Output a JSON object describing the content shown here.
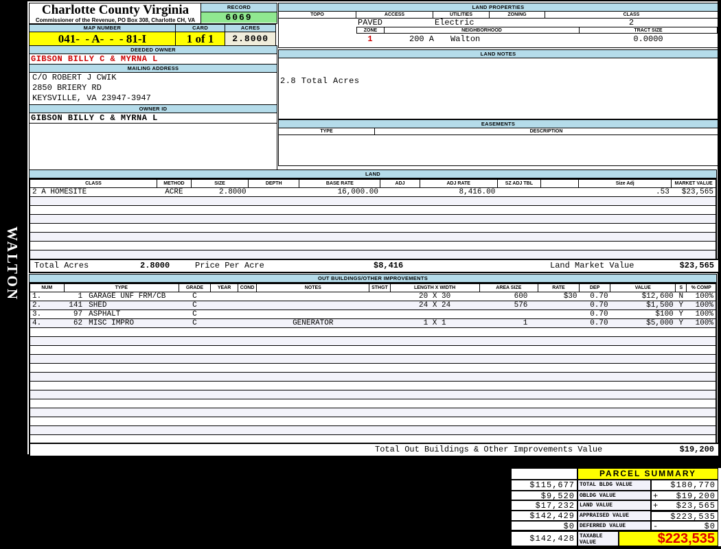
{
  "app": {
    "title": "Charlotte County Virginia",
    "subtitle": "Commissioner of the Revenue, PO Box 308, Charlotte CH, VA"
  },
  "sidebar": {
    "vertical_label": "WALTON"
  },
  "record": {
    "label": "RECORD",
    "value": "6069"
  },
  "map": {
    "label": "MAP NUMBER",
    "value": "041-  - A-  -  - 81-I"
  },
  "card": {
    "label": "CARD",
    "value": "1 of 1"
  },
  "acres": {
    "label": "ACRES",
    "value": "2.8000"
  },
  "owner": {
    "deeded_owner_label": "DEEDED OWNER",
    "deeded_owner": "GIBSON BILLY C & MYRNA L",
    "mailing_address_label": "MAILING ADDRESS",
    "mailing_address_lines": [
      "C/O ROBERT J CWIK",
      "2850 BRIERY RD",
      "KEYSVILLE, VA 23947-3947"
    ],
    "owner_id_label": "OWNER ID",
    "owner_id": "GIBSON BILLY C & MYRNA L"
  },
  "land_properties": {
    "title": "LAND PROPERTIES",
    "columns": [
      "TOPO",
      "ACCESS",
      "UTILITIES",
      "ZONING",
      "CLASS"
    ],
    "topo": "",
    "access": "PAVED",
    "utilities": "Electric",
    "zoning": "",
    "class": "2",
    "zone_label": "ZONE",
    "zone": "1",
    "zone_area": "200 A",
    "neighborhood_label": "NEIGHBORHOOD",
    "neighborhood": "Walton",
    "tract_size_label": "TRACT SIZE",
    "tract_size": "0.0000"
  },
  "land_notes": {
    "title": "LAND NOTES",
    "note": "2.8 Total Acres"
  },
  "easements": {
    "title": "EASEMENTS",
    "type_label": "TYPE",
    "description_label": "DESCRIPTION"
  },
  "land_table": {
    "title": "LAND",
    "columns": [
      "CLASS",
      "METHOD",
      "SIZE",
      "DEPTH",
      "BASE RATE",
      "ADJ",
      "ADJ RATE",
      "SZ ADJ TBL",
      "",
      "Size Adj",
      "MARKET VALUE"
    ],
    "row": {
      "cls": "2 A HOMESITE",
      "method": "ACRE",
      "size": "2.8000",
      "depth": "",
      "base_rate": "16,000.00",
      "adj": "",
      "adj_rate": "8,416.00",
      "sz_adj_tbl": "",
      "blank": "",
      "size_adj": ".53",
      "market_value": "$23,565"
    },
    "totals": {
      "acres_label": "Total Acres",
      "acres": "2.8000",
      "ppa_label": "Price Per Acre",
      "ppa": "$8,416",
      "lmv_label": "Land Market Value",
      "lmv": "$23,565"
    }
  },
  "outbuildings": {
    "title": "OUT BUILDINGS/OTHER IMPROVEMENTS",
    "columns": [
      "NUM",
      "TYPE",
      "GRADE",
      "YEAR",
      "COND",
      "NOTES",
      "STHGT",
      "LENGTH X WIDTH",
      "AREA SIZE",
      "RATE",
      "DEP",
      "VALUE",
      "S",
      "% COMP"
    ],
    "rows": [
      {
        "num": "1.",
        "code": "1",
        "name": "GARAGE UNF FRM/CB",
        "grade": "C",
        "year": "",
        "cond": "",
        "notes": "",
        "sthgt": "",
        "dims": "20 X 30",
        "area": "600",
        "rate": "$30",
        "dep": "0.70",
        "value": "$12,600",
        "s": "N",
        "comp": "100%"
      },
      {
        "num": "2.",
        "code": "141",
        "name": "SHED",
        "grade": "C",
        "year": "",
        "cond": "",
        "notes": "",
        "sthgt": "",
        "dims": "24 X 24",
        "area": "576",
        "rate": "",
        "dep": "0.70",
        "value": "$1,500",
        "s": "Y",
        "comp": "100%"
      },
      {
        "num": "3.",
        "code": "97",
        "name": "ASPHALT",
        "grade": "C",
        "year": "",
        "cond": "",
        "notes": "",
        "sthgt": "",
        "dims": "",
        "area": "",
        "rate": "",
        "dep": "0.70",
        "value": "$100",
        "s": "Y",
        "comp": "100%"
      },
      {
        "num": "4.",
        "code": "62",
        "name": "MISC IMPRO",
        "grade": "C",
        "year": "",
        "cond": "",
        "notes": "GENERATOR",
        "sthgt": "",
        "dims": "1 X 1",
        "area": "1",
        "rate": "",
        "dep": "0.70",
        "value": "$5,000",
        "s": "Y",
        "comp": "100%"
      }
    ],
    "total_label": "Total Out Buildings & Other Improvements Value",
    "total_value": "$19,200"
  },
  "parcel_summary": {
    "title": "PARCEL SUMMARY",
    "rows": [
      {
        "prior": "$115,677",
        "label": "TOTAL BLDG VALUE",
        "sign": "",
        "value": "$180,770"
      },
      {
        "prior": "$9,520",
        "label": "OBLDG VALUE",
        "sign": "+",
        "value": "$19,200"
      },
      {
        "prior": "$17,232",
        "label": "LAND VALUE",
        "sign": "+",
        "value": "$23,565"
      },
      {
        "prior": "$142,429",
        "label": "APPRAISED VALUE",
        "sign": "",
        "value": "$223,535"
      },
      {
        "prior": "$0",
        "label": "DEFERRED VALUE",
        "sign": "-",
        "value": "$0"
      }
    ],
    "taxable": {
      "prior": "$142,428",
      "label": "TAXABLE VALUE",
      "value": "$223,535"
    }
  },
  "colors": {
    "section_header_blue": "#b5dcea",
    "record_green": "#90e890",
    "highlight_yellow": "#ffff00",
    "acres_cream": "#f0eddb",
    "owner_red": "#cc0000",
    "taxable_red": "#dd0000",
    "row_alt": "#f3f3fa"
  }
}
